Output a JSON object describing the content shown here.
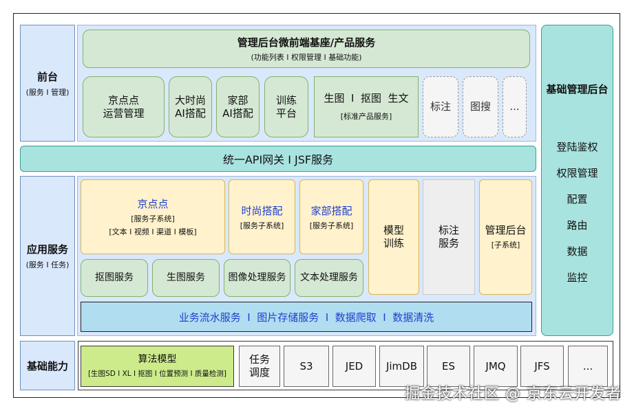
{
  "left": {
    "frontend": {
      "title": "前台",
      "sub": "(服务 I 管理)"
    },
    "app": {
      "title": "应用服务",
      "sub": "(服务 I 任务)"
    },
    "base": {
      "title": "基础能力"
    }
  },
  "top": {
    "microfrontend": {
      "title": "管理后台微前端基座/产品服务",
      "sub": "(功能列表 I 权限管理 I 基础功能)"
    },
    "apps": [
      "京点点\n运营管理",
      "大时尚\nAI搭配",
      "家部\nAI搭配",
      "训练\n平台"
    ],
    "standard": {
      "title": "生图  I  抠图  生文",
      "sub": "[标准产品服务]"
    },
    "dashed": [
      "标注",
      "图搜",
      "..."
    ]
  },
  "gateway": "统一API网关 I JSF服务",
  "right": {
    "title": "基础管理后台",
    "items": [
      "登陆鉴权",
      "权限管理",
      "配置",
      "路由",
      "数据",
      "监控"
    ]
  },
  "app_services": {
    "jdd": {
      "title": "京点点",
      "sub": "[服务子系统]",
      "sub2": "[文本 I 视频 I 渠道 I 模板]"
    },
    "fashion": {
      "title": "时尚搭配",
      "sub": "[服务子系统]"
    },
    "home": {
      "title": "家部搭配",
      "sub": "[服务子系统]"
    },
    "model_train": "模型\n训练",
    "label_service": "标注\n服务",
    "admin": {
      "title": "管理后台",
      "sub": "[子系统]"
    },
    "services": [
      "抠图服务",
      "生图服务",
      "图像处理服务",
      "文本处理服务"
    ],
    "bus": "业务流水服务  I  图片存储服务  I  数据爬取  I  数据清洗"
  },
  "base_capabilities": {
    "algo": {
      "title": "算法模型",
      "sub": "[生图SD I XL I 抠图 I 位置预测 I 质量检测]"
    },
    "items": [
      "任务\n调度",
      "S3",
      "JED",
      "JimDB",
      "ES",
      "JMQ",
      "JFS",
      "..."
    ]
  },
  "watermark": "掘金技术社区 @ 京东云开发者",
  "colors": {
    "blue_text": "#1f3fcf",
    "green_fill": "#d5e8d4",
    "cream_fill": "#fff2cc",
    "cyan_fill": "#a9e3df",
    "lime_fill": "#cdeb8b"
  }
}
